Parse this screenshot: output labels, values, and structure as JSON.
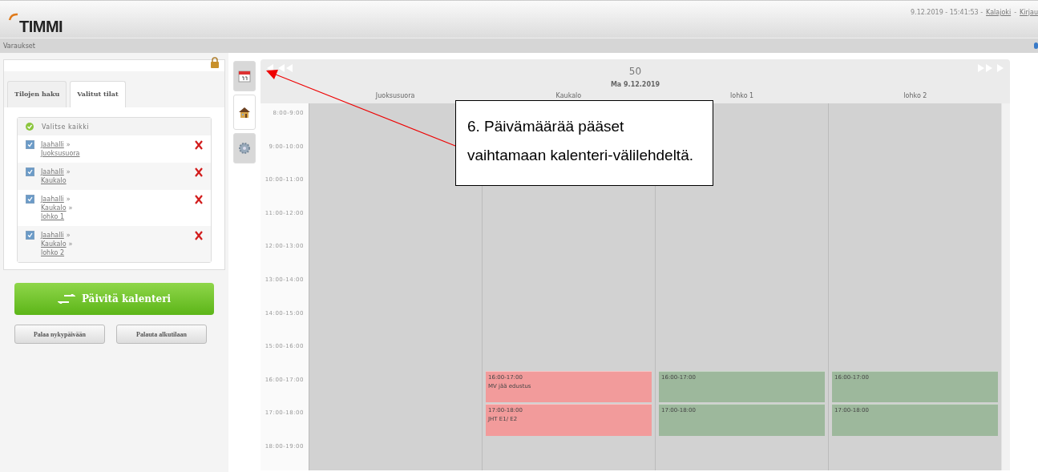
{
  "header": {
    "logo": "TIMMI",
    "datetime": "9.12.2019 - 15:41:53 -",
    "links": [
      {
        "text": "Kalajoki",
        "sep": "-"
      },
      {
        "text": "Kirjau"
      }
    ]
  },
  "subnav": {
    "title": "Varaukset"
  },
  "left_panel": {
    "tabs": [
      {
        "label": "Tilojen haku",
        "selected": false
      },
      {
        "label": "Valitut tilat",
        "selected": true
      }
    ],
    "select_all": "Valitse kaikki",
    "items": [
      {
        "checked": true,
        "segments": [
          {
            "text": "Jaahalli",
            "sep": "»"
          },
          {
            "text": "Juoksusuora"
          }
        ]
      },
      {
        "checked": true,
        "segments": [
          {
            "text": "Jaahalli",
            "sep": "»"
          },
          {
            "text": "Kaukalo"
          }
        ]
      },
      {
        "checked": true,
        "segments": [
          {
            "text": "Jaahalli",
            "sep": "»"
          },
          {
            "text": "Kaukalo",
            "sep": "»"
          },
          {
            "text": "lohko 1"
          }
        ]
      },
      {
        "checked": true,
        "segments": [
          {
            "text": "Jaahalli",
            "sep": "»"
          },
          {
            "text": "Kaukalo",
            "sep": "»"
          },
          {
            "text": "lohko 2"
          }
        ]
      }
    ],
    "update_button": "Päivitä kalenteri",
    "buttons": [
      "Palaa nykypäivään",
      "Palauta alkutilaan"
    ]
  },
  "side_tabs": [
    {
      "kind": "calendar",
      "selected": false
    },
    {
      "kind": "house",
      "selected": true
    },
    {
      "kind": "gear",
      "selected": false
    }
  ],
  "calendar": {
    "week": "50",
    "date": "Ma 9.12.2019",
    "columns": [
      "Juoksusuora",
      "Kaukalo",
      "lohko 1",
      "lohko 2"
    ],
    "rows": [
      {
        "time": "8:00-9:00",
        "cells": [
          null,
          null,
          null,
          null
        ]
      },
      {
        "time": "9:00-10:00",
        "cells": [
          null,
          null,
          null,
          null
        ]
      },
      {
        "time": "10:00-11:00",
        "cells": [
          null,
          null,
          null,
          null
        ]
      },
      {
        "time": "11:00-12:00",
        "cells": [
          null,
          null,
          null,
          null
        ]
      },
      {
        "time": "12:00-13:00",
        "cells": [
          null,
          null,
          null,
          null
        ]
      },
      {
        "time": "13:00-14:00",
        "cells": [
          null,
          null,
          null,
          null
        ]
      },
      {
        "time": "14:00-15:00",
        "cells": [
          null,
          null,
          null,
          null
        ]
      },
      {
        "time": "15:00-16:00",
        "cells": [
          null,
          null,
          null,
          null
        ]
      },
      {
        "time": "16:00-17:00",
        "cells": [
          null,
          {
            "time": "16:00-17:00",
            "title": "MV jää edustus",
            "color": "#f29b9b"
          },
          {
            "time": "16:00-17:00",
            "color": "#9db89c"
          },
          {
            "time": "16:00-17:00",
            "color": "#9db89c"
          }
        ]
      },
      {
        "time": "17:00-18:00",
        "cells": [
          null,
          {
            "time": "17:00-18:00",
            "title": "JHT E1/ E2",
            "color": "#f29b9b"
          },
          {
            "time": "17:00-18:00",
            "color": "#9db89c"
          },
          {
            "time": "17:00-18:00",
            "color": "#9db89c"
          }
        ]
      },
      {
        "time": "18:00-19:00",
        "cells": [
          null,
          null,
          null,
          null
        ]
      }
    ]
  },
  "callout": {
    "text": "6. Päivämäärää pääset vaihtamaan kalenteri-välilehdeltä."
  }
}
